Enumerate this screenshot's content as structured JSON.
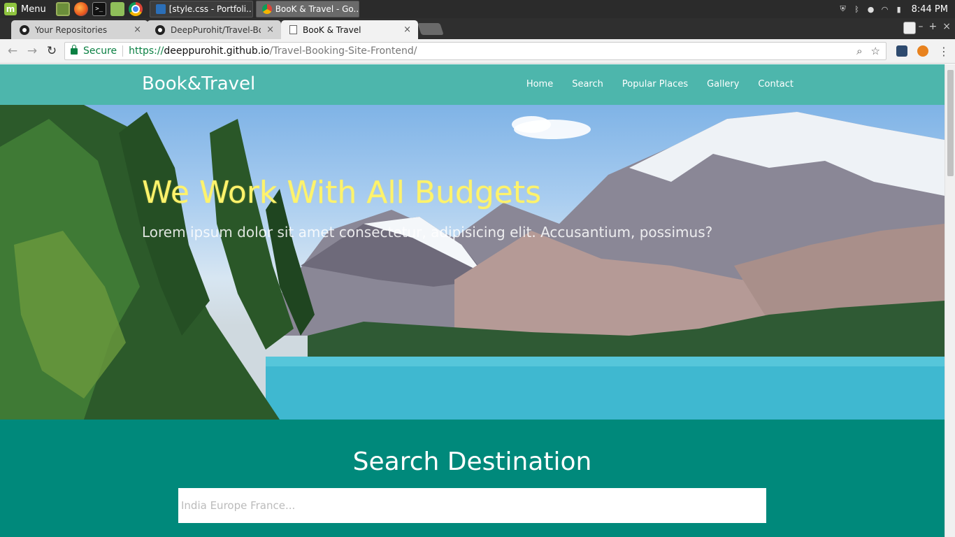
{
  "taskbar": {
    "menu_label": "Menu",
    "mint_letter": "m",
    "launchers": [
      "desktop-icon",
      "firefox-icon",
      "terminal-icon",
      "files-icon",
      "chrome-icon"
    ],
    "terminal_glyph": ">_",
    "windows": [
      {
        "title": "[style.css - Portfoli...",
        "icon": "vscode-icon",
        "active": false
      },
      {
        "title": "BooK & Travel - Go...",
        "icon": "chrome-icon",
        "active": true
      }
    ],
    "clock": "8:44 PM"
  },
  "browser": {
    "tabs": [
      {
        "label": "Your Repositories",
        "icon": "github-icon"
      },
      {
        "label": "DeepPurohit/Travel-Boo",
        "icon": "github-icon"
      },
      {
        "label": "BooK & Travel",
        "icon": "page-icon",
        "active": true
      }
    ],
    "close_glyph": "×",
    "address": {
      "secure_label": "Secure",
      "scheme": "https://",
      "host": "deeppurohit.github.io",
      "path": "/Travel-Booking-Site-Frontend/"
    },
    "window_controls": [
      "–",
      "+",
      "×"
    ]
  },
  "site": {
    "brand": "Book&Travel",
    "nav": [
      "Home",
      "Search",
      "Popular Places",
      "Gallery",
      "Contact"
    ],
    "hero": {
      "title": "We Work With All Budgets",
      "subtitle": "Lorem ipsum dolor sit amet consectetur, adipisicing elit. Accusantium, possimus?"
    },
    "search": {
      "title": "Search Destination",
      "placeholder": "India Europe France..."
    }
  },
  "colors": {
    "nav_bg": "#4db6ac",
    "search_bg": "#00897b",
    "hero_title": "#fff36b"
  }
}
